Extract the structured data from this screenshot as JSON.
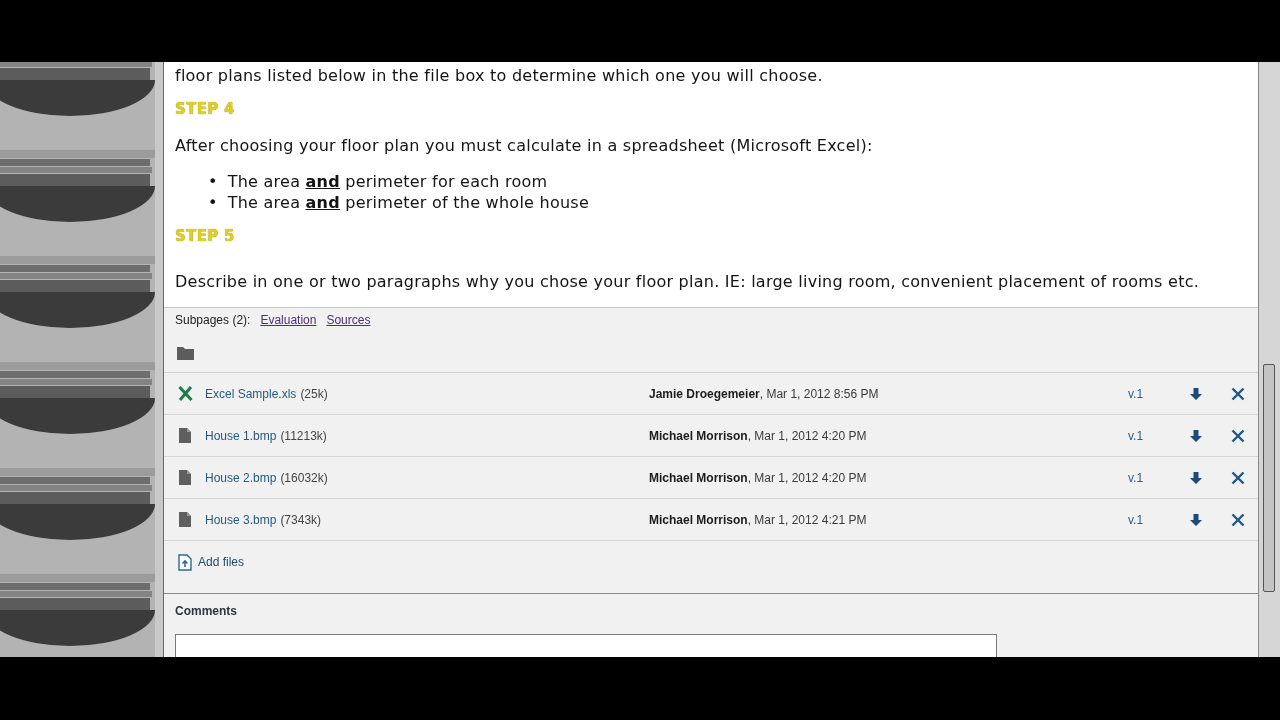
{
  "article": {
    "intro": "floor plans listed below in the file box to determine which one you will choose.",
    "steps": [
      {
        "heading": "STEP 4",
        "text": "After choosing your floor plan you must calculate in a spreadsheet (Microsoft Excel):",
        "bullets": [
          {
            "marker": "•",
            "text": "The area **and** perimeter for each room"
          },
          {
            "marker": "•",
            "text": "The area **and** perimeter of the whole house"
          }
        ]
      },
      {
        "heading": "STEP 5",
        "text": "Describe in one or two paragraphs why you chose your floor plan. IE: large living room, convenient placement of rooms etc."
      }
    ]
  },
  "subpages": {
    "label": "Subpages (2):",
    "links": [
      "Evaluation",
      "Sources"
    ]
  },
  "files": [
    {
      "kind": "spreadsheet",
      "name": "Excel Sample.xls",
      "size": "(25k)",
      "uploaded": "**Jamie Droegemeier**, Mar 1, 2012 8:56 PM",
      "version": "v.1"
    },
    {
      "kind": "document",
      "name": "House 1.bmp",
      "size": "(11213k)",
      "uploaded": "**Michael Morrison**, Mar 1, 2012 4:20 PM",
      "version": "v.1"
    },
    {
      "kind": "document",
      "name": "House 2.bmp",
      "size": "(16032k)",
      "uploaded": "**Michael Morrison**, Mar 1, 2012 4:20 PM",
      "version": "v.1"
    },
    {
      "kind": "document",
      "name": "House 3.bmp",
      "size": "(7343k)",
      "uploaded": "**Michael Morrison**, Mar 1, 2012 4:21 PM",
      "version": "v.1"
    }
  ],
  "add_files": "Add files",
  "comments": {
    "title": "Comments"
  }
}
